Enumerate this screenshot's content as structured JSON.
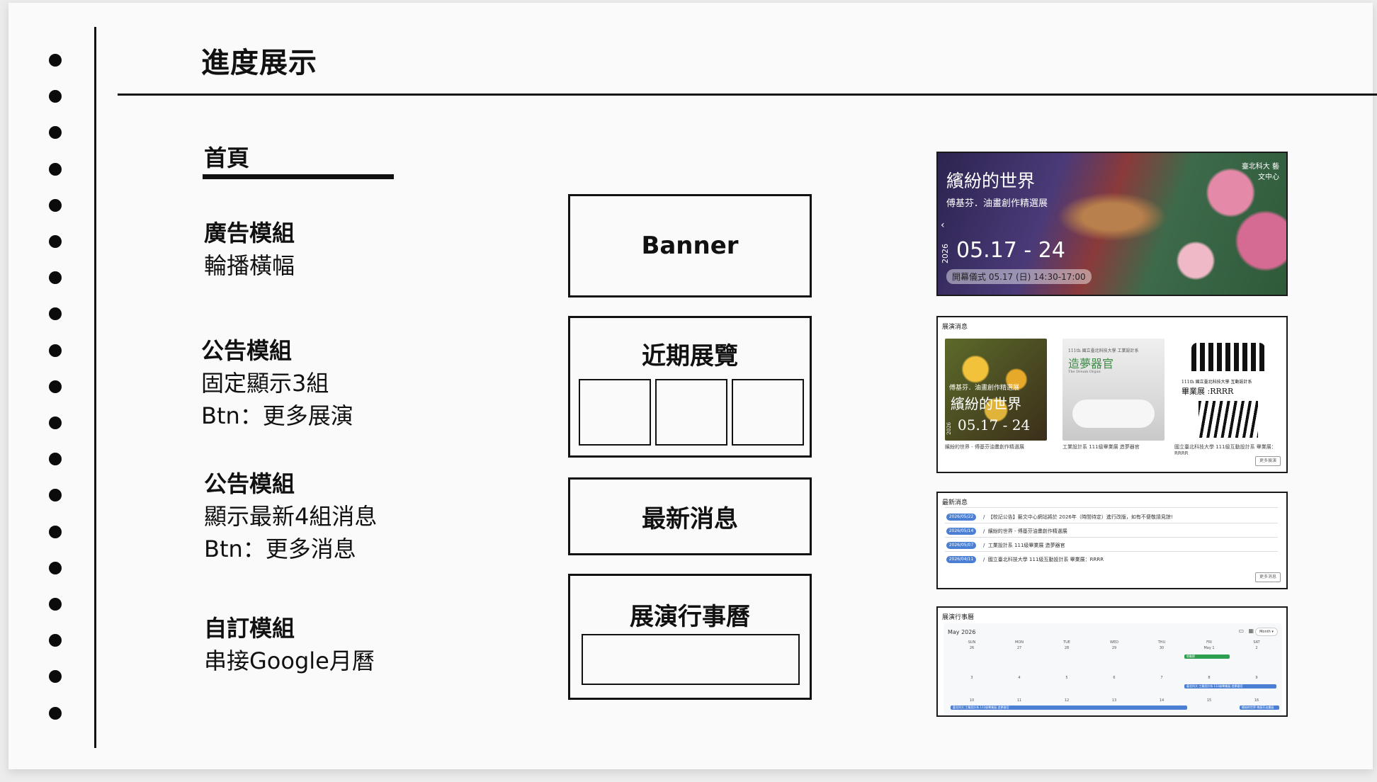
{
  "page": {
    "title": "進度展示"
  },
  "section": {
    "title": "首頁"
  },
  "modules": [
    {
      "name": "廣告模組",
      "lines": [
        "輪播橫幅"
      ]
    },
    {
      "name": "公告模組",
      "lines": [
        "固定顯示3組",
        "Btn：更多展演"
      ]
    },
    {
      "name": "公告模組",
      "lines": [
        "顯示最新4組消息",
        "Btn：更多消息"
      ]
    },
    {
      "name": "自訂模組",
      "lines": [
        "串接Google月曆"
      ]
    }
  ],
  "wireframes": {
    "banner": "Banner",
    "exhibitions": "近期展覽",
    "news": "最新消息",
    "calendar": "展演行事曆"
  },
  "preview_banner": {
    "title": "繽紛的世界",
    "subtitle": "傅基芬．油畫創作精選展",
    "year": "2026",
    "date": "05.17 - 24",
    "opening": "開幕儀式 05.17 (日) 14:30-17:00",
    "org": "臺北科大 藝文中心"
  },
  "preview_exhibitions": {
    "heading": "展演消息",
    "card1": {
      "subtitle": "傅基芬．油畫創作精選展",
      "title": "繽紛的世界",
      "year": "2026",
      "date": "05.17 - 24"
    },
    "card2": {
      "top": "111th 國立臺北科技大學 工業設計系",
      "title": "造夢器官",
      "en": "The Dream Organ"
    },
    "card3": {
      "top": "111th 國立臺北科技大學 互動設計系",
      "title": "畢業展 :RRRR"
    },
    "captions": [
      "繽紛的世界 - 傅基芬油畫創作精選展",
      "工業設計系 111級畢業展 造夢器官",
      "國立臺北科技大學 111級互動設計系 畢業展：RRRR"
    ],
    "more": "更多展演"
  },
  "preview_news": {
    "heading": "最新消息",
    "items": [
      {
        "date": "2026/05/22",
        "text": "【校記公告】藝文中心網站將於 2026年（時間待定）進行改版，如有不便敬請見諒!"
      },
      {
        "date": "2026/05/14",
        "text": "繽紛的世界 - 傅基芬油畫創作精選展"
      },
      {
        "date": "2026/05/07",
        "text": "工業設計系 111級畢業展 造夢器官"
      },
      {
        "date": "2026/04/11",
        "text": "國立臺北科技大學 111級互動設計系 畢業展：RRRR"
      }
    ],
    "more": "更多消息"
  },
  "preview_calendar": {
    "heading": "展演行事曆",
    "month": "May 2026",
    "view": "Month",
    "days": [
      "SUN",
      "MON",
      "TUE",
      "WED",
      "THU",
      "FRI",
      "SAT"
    ],
    "week1": [
      "26",
      "27",
      "28",
      "29",
      "30",
      "May 1",
      "2"
    ],
    "week2": [
      "3",
      "4",
      "5",
      "6",
      "7",
      "8",
      "9"
    ],
    "week3": [
      "10",
      "11",
      "12",
      "13",
      "14",
      "15",
      "16"
    ],
    "events": [
      "勞動節",
      "臺北科大 工業設計系 111級畢業展 造夢器官",
      "臺北科大 工業設計系 111級畢業展 造夢器官",
      "繽紛的世界 傅基芬油畫展"
    ]
  },
  "colors": {
    "ink": "#111111",
    "accent_blue": "#4a7fd4",
    "event_green": "#2e9e4f"
  }
}
